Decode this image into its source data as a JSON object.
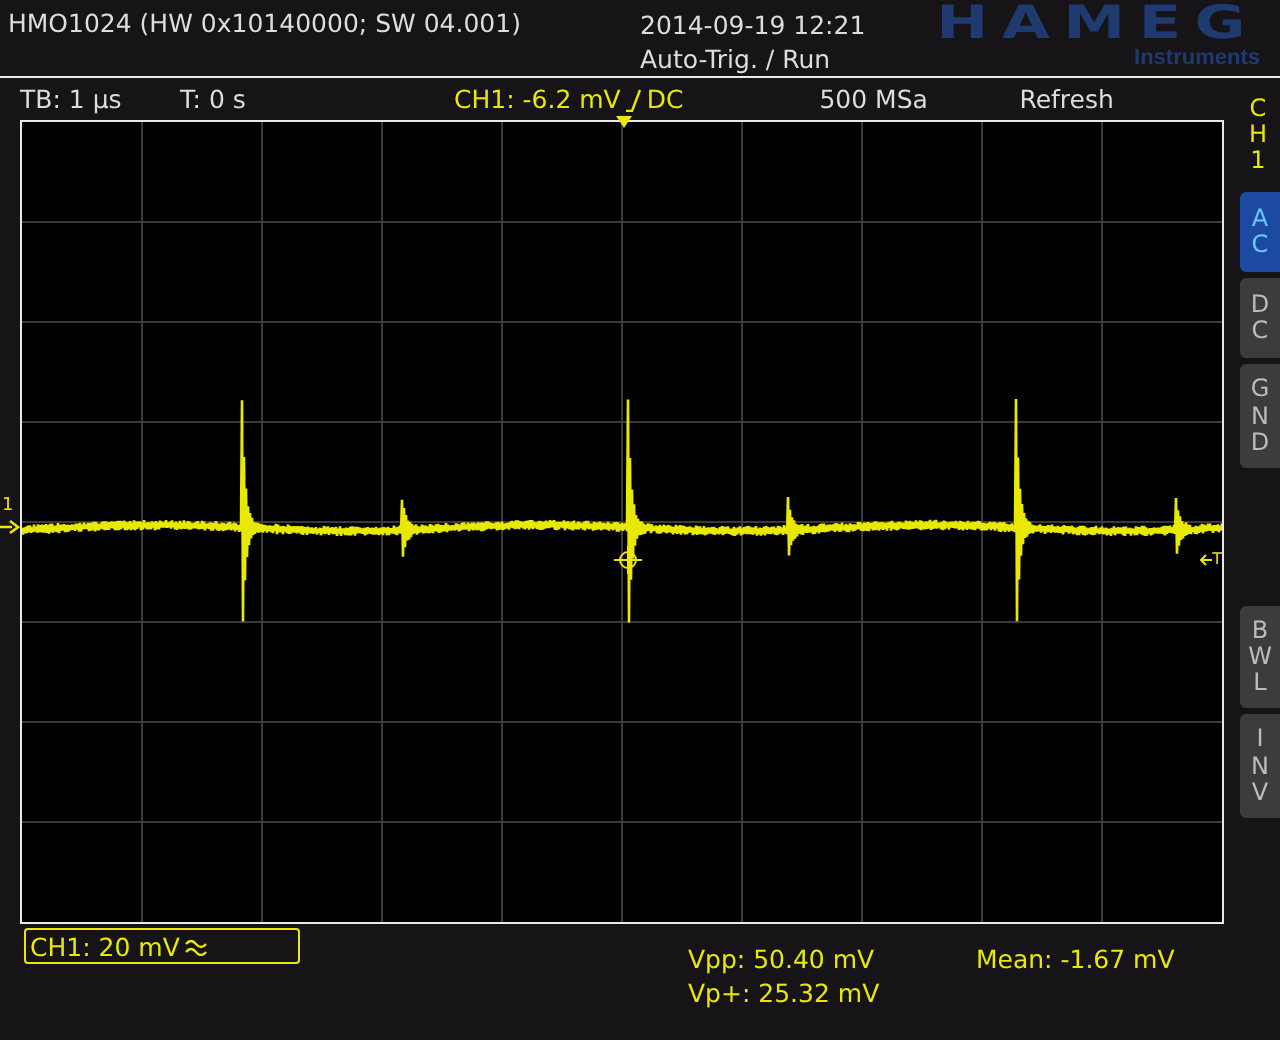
{
  "header": {
    "title": "HMO1024 (HW 0x10140000; SW 04.001)",
    "timestamp": "2014-09-19 12:21",
    "trigger_status": "Auto-Trig. / Run",
    "logo": {
      "brand": "HAMEG",
      "subtitle": "Instruments"
    }
  },
  "status_bar": {
    "timebase": "TB: 1 µs",
    "trigger_time": "T: 0 s",
    "trigger_level": "CH1: -6.2 mV",
    "trigger_coupling": "DC",
    "sample_rate": "500 MSa",
    "acquisition_mode": "Refresh"
  },
  "display": {
    "channel_marker": "1",
    "trigger_marker": "T"
  },
  "channel_menu": {
    "title": "CH1",
    "buttons": [
      {
        "label": "AC",
        "selected": true
      },
      {
        "label": "DC",
        "selected": false
      },
      {
        "label": "GND",
        "selected": false
      },
      {
        "label": "BWL",
        "selected": false
      },
      {
        "label": "INV",
        "selected": false
      }
    ]
  },
  "readouts": {
    "channel_scale": "CH1: 20 mV",
    "measurements": [
      {
        "text": "Vpp: 50.40 mV"
      },
      {
        "text": "Mean: -1.67 mV"
      },
      {
        "text": "Vp+: 25.32 mV"
      }
    ]
  }
}
